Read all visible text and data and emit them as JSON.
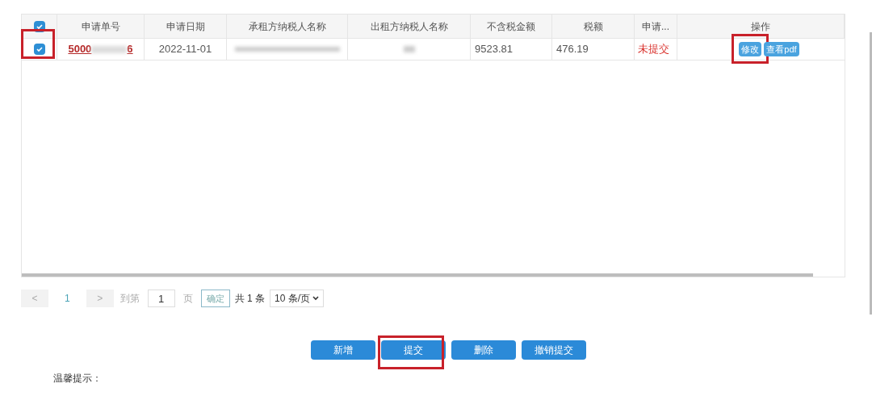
{
  "table": {
    "header_checked": true,
    "columns": [
      "申请单号",
      "申请日期",
      "承租方纳税人名称",
      "出租方纳税人名称",
      "不含税金额",
      "税额",
      "申请...",
      "操作"
    ],
    "rows": [
      {
        "checked": true,
        "highlighted": true,
        "number_prefix": "5000",
        "number_suffix": "6",
        "date": "2022-11-01",
        "amount": "9523.81",
        "tax": "476.19",
        "status": "未提交",
        "actions": [
          {
            "label": "修改",
            "highlighted": true
          },
          {
            "label": "查看pdf",
            "highlighted": false
          }
        ]
      }
    ]
  },
  "pagination": {
    "prev": "<",
    "page": "1",
    "next": ">",
    "goto_label": "到第",
    "goto_value": "1",
    "page_unit": "页",
    "confirm": "确定",
    "total": "共 1 条",
    "page_size": "10 条/页"
  },
  "buttons": [
    {
      "label": "新增",
      "highlighted": false
    },
    {
      "label": "提交",
      "highlighted": true
    },
    {
      "label": "删除",
      "highlighted": false
    },
    {
      "label": "撤销提交",
      "highlighted": false
    }
  ],
  "tips_title": "温馨提示："
}
